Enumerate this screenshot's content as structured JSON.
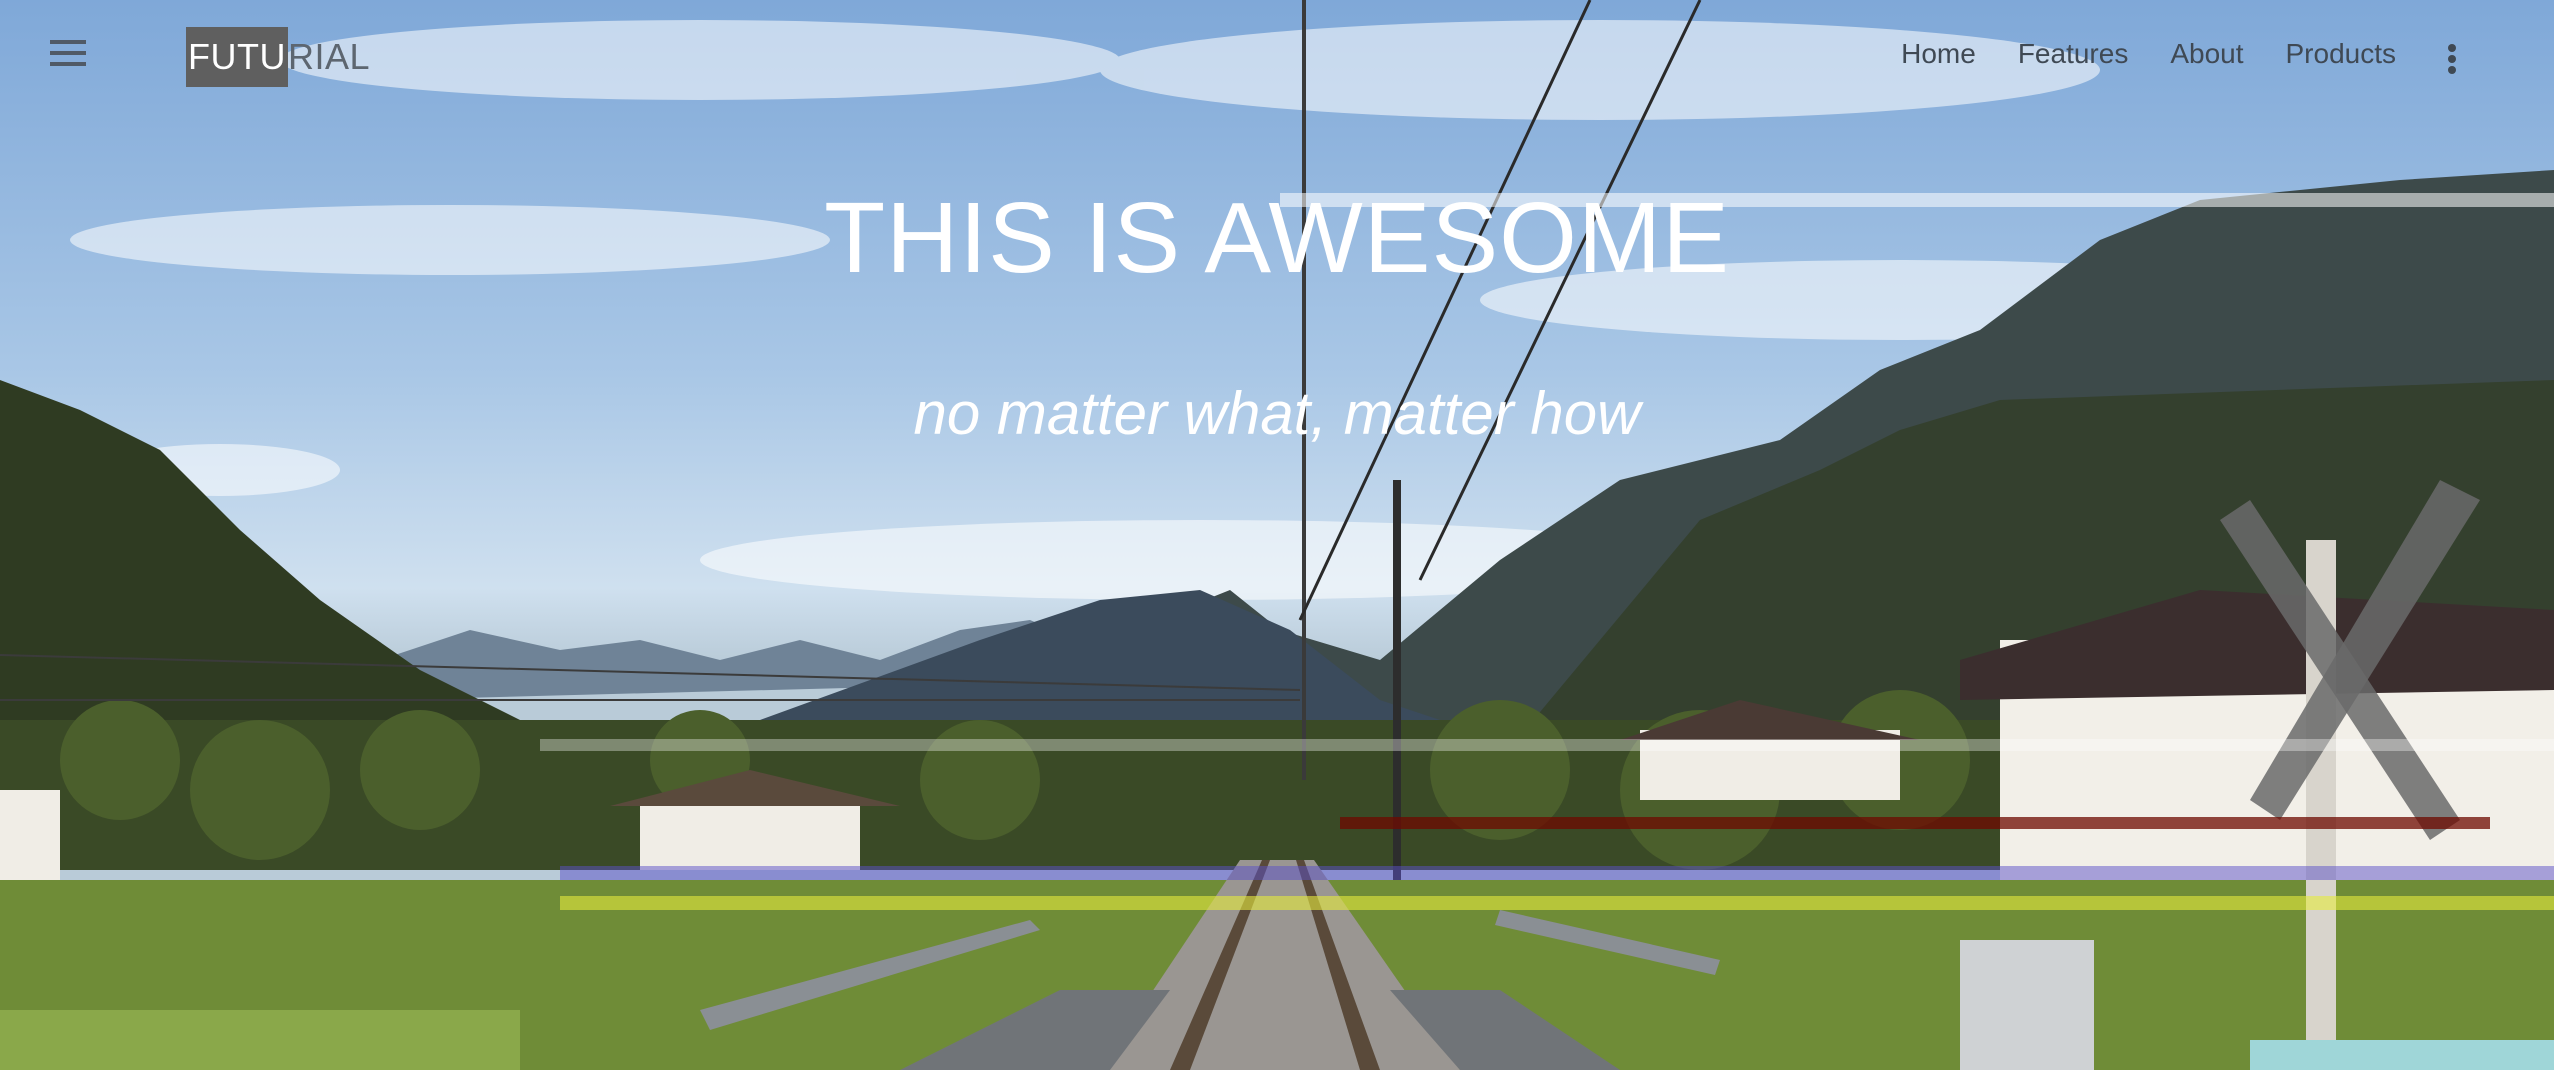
{
  "header": {
    "logo_part1": "FUTU",
    "logo_part2": "RIAL",
    "nav": [
      "Home",
      "Features",
      "About",
      "Products"
    ]
  },
  "hero": {
    "title": "THIS IS AWESOME",
    "subtitle": "no matter what, matter how"
  },
  "colors": {
    "sky_top": "#7fa8d8",
    "mountain": "#3f4f5e",
    "forest": "#2e3c22",
    "grass": "#7c9a3e",
    "text_light": "#ffffff",
    "nav_text": "#3f4954"
  },
  "icons": {
    "menu": "hamburger-menu-icon",
    "more": "vertical-dots-icon"
  }
}
